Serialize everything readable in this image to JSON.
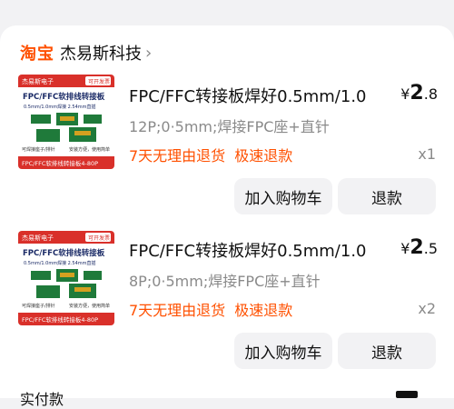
{
  "shop": {
    "platform": "淘宝",
    "name": "杰易斯科技",
    "chevron": "chevron-right-icon"
  },
  "items": [
    {
      "thumb": {
        "brand": "杰易斯电子",
        "badge": "可开发票",
        "headline": "FPC/FFC软排线转接板",
        "sub": "0.5mm/1.0mm焊接 2.54mm直插",
        "footer_left": "可焊接座子/排针",
        "footer_right": "安装方便，使用简单",
        "bottom_band": "FPC/FFC软排线转接板4-80P"
      },
      "title": "FPC/FFC转接板焊好0.5mm/1.0",
      "price": {
        "symbol": "¥",
        "integer": "2",
        "decimal": ".8"
      },
      "spec": "12P;0·5mm;焊接FPC座+直针",
      "promos": [
        "7天无理由退货",
        "极速退款"
      ],
      "quantity": "x1",
      "buttons": {
        "cart": "加入购物车",
        "refund": "退款"
      }
    },
    {
      "thumb": {
        "brand": "杰易斯电子",
        "badge": "可开发票",
        "headline": "FPC/FFC软排线转接板",
        "sub": "0.5mm/1.0mm焊接 2.54mm直插",
        "footer_left": "可焊接座子/排针",
        "footer_right": "安装方便，使用简单",
        "bottom_band": "FPC/FFC软排线转接板4-80P"
      },
      "title": "FPC/FFC转接板焊好0.5mm/1.0",
      "price": {
        "symbol": "¥",
        "integer": "2",
        "decimal": ".5"
      },
      "spec": "8P;0·5mm;焊接FPC座+直针",
      "promos": [
        "7天无理由退货",
        "极速退款"
      ],
      "quantity": "x2",
      "buttons": {
        "cart": "加入购物车",
        "refund": "退款"
      }
    }
  ],
  "bottom_peek": "实付款"
}
